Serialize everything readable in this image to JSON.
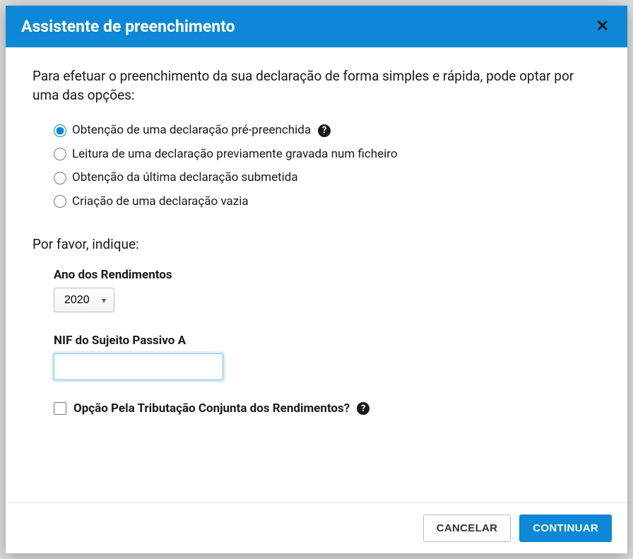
{
  "modal": {
    "title": "Assistente de preenchimento",
    "intro": "Para efetuar o preenchimento da sua declaração de forma simples e rápida, pode optar por uma das opções:",
    "options": [
      {
        "label": "Obtenção de uma declaração pré-preenchida",
        "help": true,
        "selected": true
      },
      {
        "label": "Leitura de uma declaração previamente gravada num ficheiro",
        "help": false,
        "selected": false
      },
      {
        "label": "Obtenção da última declaração submetida",
        "help": false,
        "selected": false
      },
      {
        "label": "Criação de uma declaração vazia",
        "help": false,
        "selected": false
      }
    ],
    "section_label": "Por favor, indique:",
    "year": {
      "label": "Ano dos Rendimentos",
      "value": "2020"
    },
    "nif": {
      "label": "NIF do Sujeito Passivo A",
      "value": ""
    },
    "joint": {
      "label": "Opção Pela Tributação Conjunta dos Rendimentos?",
      "checked": false
    },
    "buttons": {
      "cancel": "CANCELAR",
      "continue": "CONTINUAR"
    }
  }
}
